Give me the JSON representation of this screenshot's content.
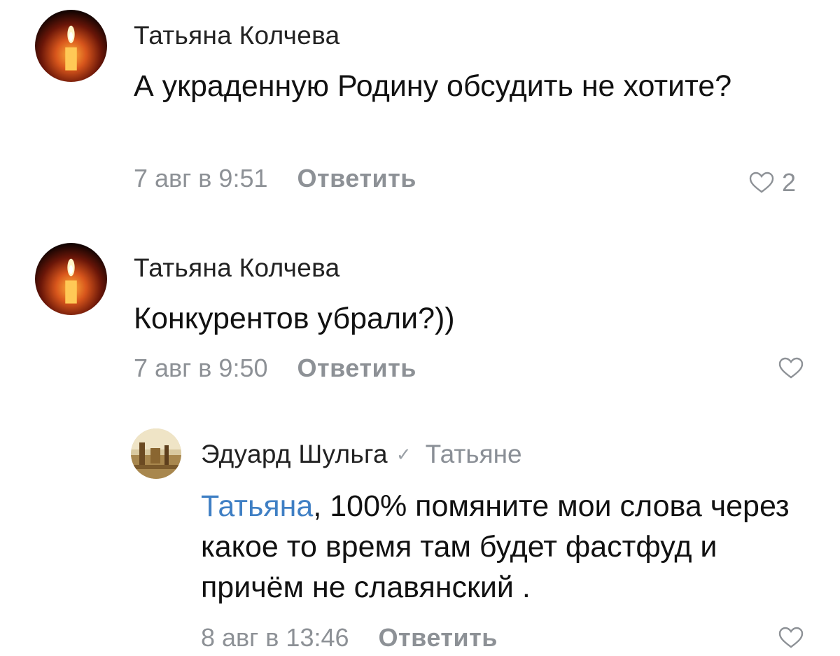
{
  "comments": [
    {
      "author": "Татьяна Колчева",
      "text": "А украденную Родину обсудить не хотите?",
      "date": "7 авг в 9:51",
      "reply_label": "Ответить",
      "likes": "2",
      "avatar_icon": "candle-icon"
    },
    {
      "author": "Татьяна Колчева",
      "text": "Конкурентов убрали?))",
      "date": "7 авг в 9:50",
      "reply_label": "Ответить",
      "avatar_icon": "candle-icon"
    }
  ],
  "reply": {
    "author": "Эдуард Шульга",
    "verified_icon": "checkmark-icon",
    "reply_to": "Татьяне",
    "mention": "Татьяна",
    "text": ", 100% помяните мои слова через какое то время там будет фастфуд и причём не славянский .",
    "date": "8 авг в 13:46",
    "reply_label": "Ответить",
    "avatar_icon": "landscape-avatar-icon"
  },
  "colors": {
    "mention": "#3f7fc4",
    "meta": "#8d9196",
    "author": "#222222"
  }
}
